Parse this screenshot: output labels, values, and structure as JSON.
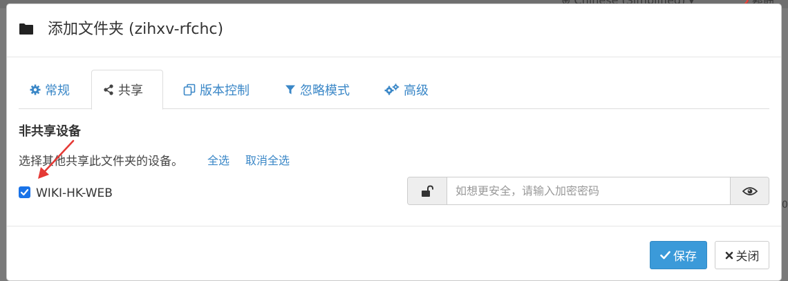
{
  "background": {
    "nav_left_text": "",
    "nav_lang_text": "Chinese (Simplified)",
    "nav_help_text": "帮助",
    "side_glyph": "0"
  },
  "modal": {
    "title": "添加文件夹 (zihxv-rfchc)",
    "tabs": [
      {
        "label": "常规",
        "icon": "gear-icon",
        "active": false
      },
      {
        "label": "共享",
        "icon": "share-icon",
        "active": true
      },
      {
        "label": "版本控制",
        "icon": "copy-icon",
        "active": false
      },
      {
        "label": "忽略模式",
        "icon": "filter-icon",
        "active": false
      },
      {
        "label": "高级",
        "icon": "gears-icon",
        "active": false
      }
    ],
    "section_title": "非共享设备",
    "hint": "选择其他共享此文件夹的设备。",
    "select_all": "全选",
    "deselect_all": "取消全选",
    "device": {
      "name": "WIKI-HK-WEB",
      "checked": true
    },
    "password": {
      "value": "",
      "placeholder": "如想更安全，请输入加密密码"
    },
    "buttons": {
      "save": "保存",
      "close": "关闭"
    }
  },
  "colors": {
    "accent": "#3a87c7",
    "save_button": "#3b9ad9",
    "checkbox": "#1a73e8",
    "annotation_arrow": "#e53935"
  }
}
